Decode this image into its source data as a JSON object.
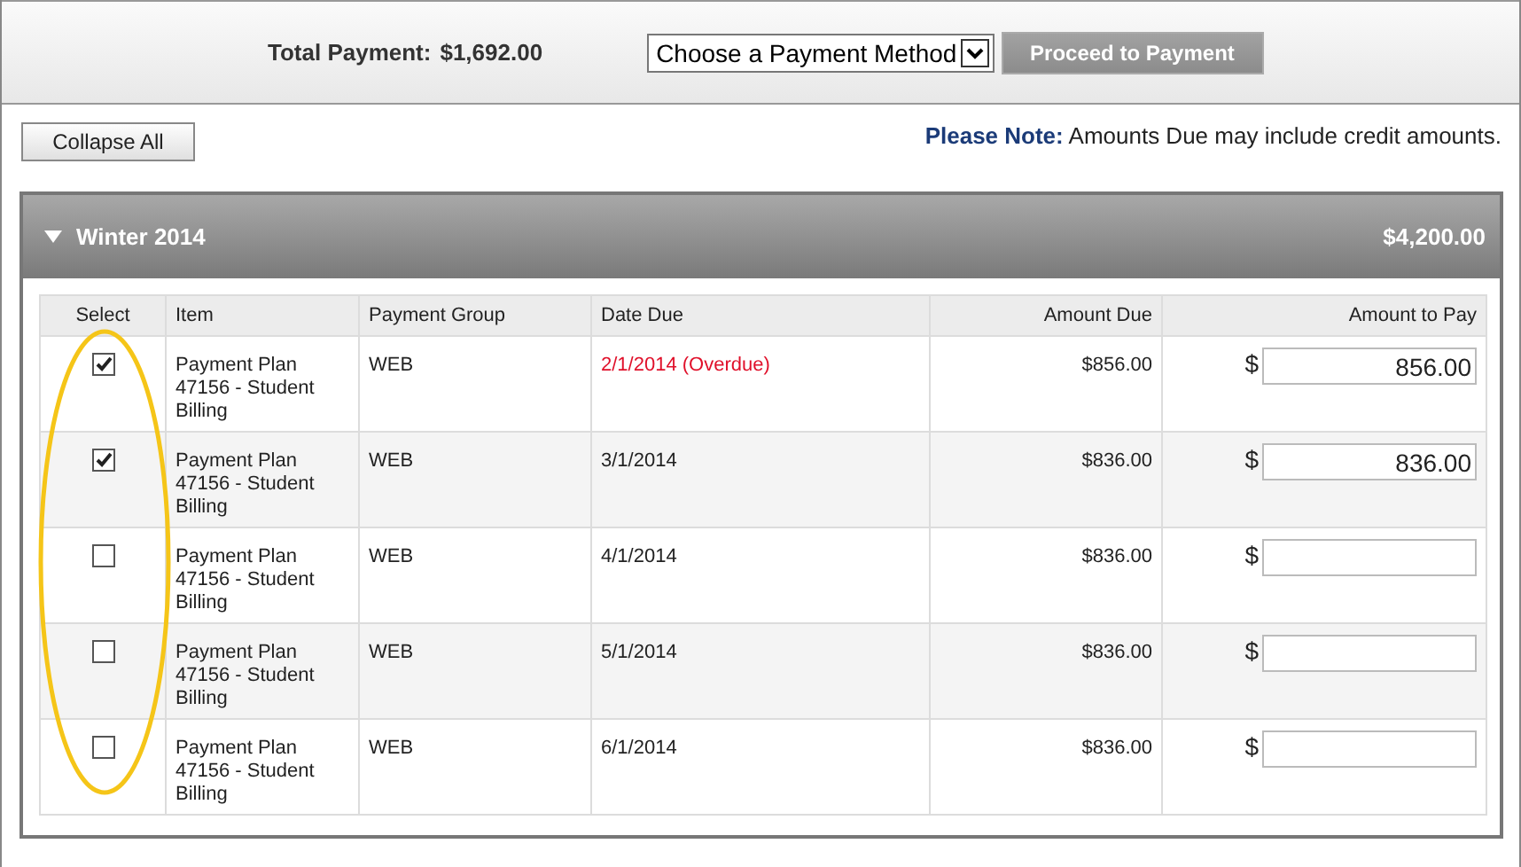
{
  "summary": {
    "total_label": "Total Payment:",
    "total_value": "$1,692.00",
    "method_select": {
      "value": "Choose a Payment Method"
    },
    "proceed_button": {
      "label": "Proceed to Payment",
      "disabled": true
    }
  },
  "collapse_button": "Collapse All",
  "note": {
    "label": "Please Note:",
    "text": "Amounts Due may include credit amounts."
  },
  "section": {
    "title": "Winter 2014",
    "total": "$4,200.00",
    "expanded": true,
    "columns": [
      "Select",
      "Item",
      "Payment Group",
      "Date Due",
      "Amount Due",
      "Amount to Pay"
    ],
    "rows": [
      {
        "checked": true,
        "item": "Payment Plan 47156 - Student Billing",
        "group": "WEB",
        "date_due": "2/1/2014 (Overdue)",
        "overdue": true,
        "amount_due": "$856.00",
        "currency": "$",
        "pay": "856.00"
      },
      {
        "checked": true,
        "item": "Payment Plan 47156 - Student Billing",
        "group": "WEB",
        "date_due": "3/1/2014",
        "overdue": false,
        "amount_due": "$836.00",
        "currency": "$",
        "pay": "836.00"
      },
      {
        "checked": false,
        "item": "Payment Plan 47156 - Student Billing",
        "group": "WEB",
        "date_due": "4/1/2014",
        "overdue": false,
        "amount_due": "$836.00",
        "currency": "$"
      },
      {
        "checked": false,
        "item": "Payment Plan 47156 - Student Billing",
        "group": "WEB",
        "date_due": "5/1/2014",
        "overdue": false,
        "amount_due": "$836.00",
        "currency": "$"
      },
      {
        "checked": false,
        "item": "Payment Plan 47156 - Student Billing",
        "group": "WEB",
        "date_due": "6/1/2014",
        "overdue": false,
        "amount_due": "$836.00",
        "currency": "$"
      }
    ]
  }
}
